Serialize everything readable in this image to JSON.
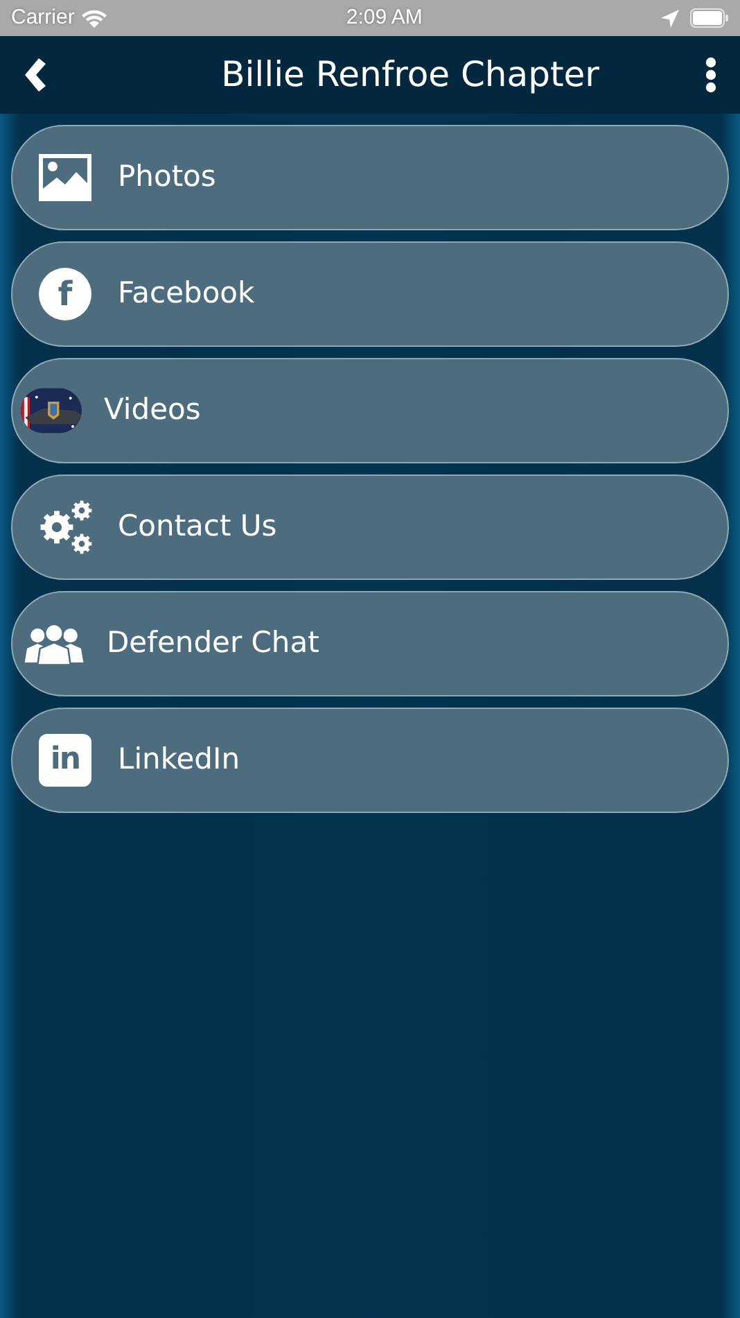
{
  "status_bar": {
    "carrier": "Carrier",
    "time": "2:09 AM"
  },
  "nav_bar": {
    "title": "Billie Renfroe Chapter"
  },
  "menu_items": [
    {
      "label": "Photos",
      "kind": "photos"
    },
    {
      "label": "Facebook",
      "kind": "facebook",
      "icon_glyph": "f"
    },
    {
      "label": "Videos",
      "kind": "picture"
    },
    {
      "label": "Contact Us",
      "kind": "gears"
    },
    {
      "label": "Defender Chat",
      "kind": "people"
    },
    {
      "label": "LinkedIn",
      "kind": "linkedin",
      "icon_glyph": "in"
    }
  ]
}
